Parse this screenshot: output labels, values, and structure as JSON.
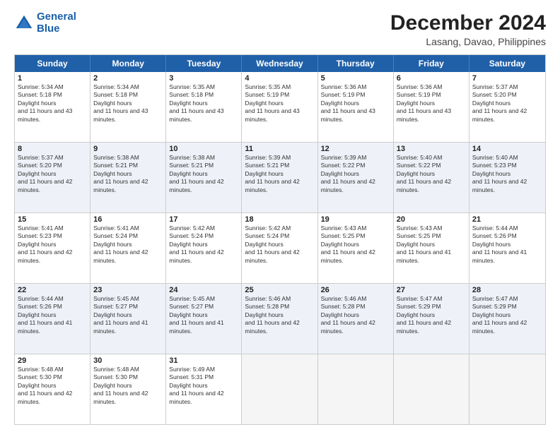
{
  "logo": {
    "line1": "General",
    "line2": "Blue"
  },
  "title": "December 2024",
  "subtitle": "Lasang, Davao, Philippines",
  "days": [
    "Sunday",
    "Monday",
    "Tuesday",
    "Wednesday",
    "Thursday",
    "Friday",
    "Saturday"
  ],
  "rows": [
    [
      {
        "day": "1",
        "rise": "5:34 AM",
        "set": "5:18 PM",
        "dl": "11 hours and 43 minutes."
      },
      {
        "day": "2",
        "rise": "5:34 AM",
        "set": "5:18 PM",
        "dl": "11 hours and 43 minutes."
      },
      {
        "day": "3",
        "rise": "5:35 AM",
        "set": "5:18 PM",
        "dl": "11 hours and 43 minutes."
      },
      {
        "day": "4",
        "rise": "5:35 AM",
        "set": "5:19 PM",
        "dl": "11 hours and 43 minutes."
      },
      {
        "day": "5",
        "rise": "5:36 AM",
        "set": "5:19 PM",
        "dl": "11 hours and 43 minutes."
      },
      {
        "day": "6",
        "rise": "5:36 AM",
        "set": "5:19 PM",
        "dl": "11 hours and 43 minutes."
      },
      {
        "day": "7",
        "rise": "5:37 AM",
        "set": "5:20 PM",
        "dl": "11 hours and 42 minutes."
      }
    ],
    [
      {
        "day": "8",
        "rise": "5:37 AM",
        "set": "5:20 PM",
        "dl": "11 hours and 42 minutes."
      },
      {
        "day": "9",
        "rise": "5:38 AM",
        "set": "5:21 PM",
        "dl": "11 hours and 42 minutes."
      },
      {
        "day": "10",
        "rise": "5:38 AM",
        "set": "5:21 PM",
        "dl": "11 hours and 42 minutes."
      },
      {
        "day": "11",
        "rise": "5:39 AM",
        "set": "5:21 PM",
        "dl": "11 hours and 42 minutes."
      },
      {
        "day": "12",
        "rise": "5:39 AM",
        "set": "5:22 PM",
        "dl": "11 hours and 42 minutes."
      },
      {
        "day": "13",
        "rise": "5:40 AM",
        "set": "5:22 PM",
        "dl": "11 hours and 42 minutes."
      },
      {
        "day": "14",
        "rise": "5:40 AM",
        "set": "5:23 PM",
        "dl": "11 hours and 42 minutes."
      }
    ],
    [
      {
        "day": "15",
        "rise": "5:41 AM",
        "set": "5:23 PM",
        "dl": "11 hours and 42 minutes."
      },
      {
        "day": "16",
        "rise": "5:41 AM",
        "set": "5:24 PM",
        "dl": "11 hours and 42 minutes."
      },
      {
        "day": "17",
        "rise": "5:42 AM",
        "set": "5:24 PM",
        "dl": "11 hours and 42 minutes."
      },
      {
        "day": "18",
        "rise": "5:42 AM",
        "set": "5:24 PM",
        "dl": "11 hours and 42 minutes."
      },
      {
        "day": "19",
        "rise": "5:43 AM",
        "set": "5:25 PM",
        "dl": "11 hours and 42 minutes."
      },
      {
        "day": "20",
        "rise": "5:43 AM",
        "set": "5:25 PM",
        "dl": "11 hours and 41 minutes."
      },
      {
        "day": "21",
        "rise": "5:44 AM",
        "set": "5:26 PM",
        "dl": "11 hours and 41 minutes."
      }
    ],
    [
      {
        "day": "22",
        "rise": "5:44 AM",
        "set": "5:26 PM",
        "dl": "11 hours and 41 minutes."
      },
      {
        "day": "23",
        "rise": "5:45 AM",
        "set": "5:27 PM",
        "dl": "11 hours and 41 minutes."
      },
      {
        "day": "24",
        "rise": "5:45 AM",
        "set": "5:27 PM",
        "dl": "11 hours and 41 minutes."
      },
      {
        "day": "25",
        "rise": "5:46 AM",
        "set": "5:28 PM",
        "dl": "11 hours and 42 minutes."
      },
      {
        "day": "26",
        "rise": "5:46 AM",
        "set": "5:28 PM",
        "dl": "11 hours and 42 minutes."
      },
      {
        "day": "27",
        "rise": "5:47 AM",
        "set": "5:29 PM",
        "dl": "11 hours and 42 minutes."
      },
      {
        "day": "28",
        "rise": "5:47 AM",
        "set": "5:29 PM",
        "dl": "11 hours and 42 minutes."
      }
    ],
    [
      {
        "day": "29",
        "rise": "5:48 AM",
        "set": "5:30 PM",
        "dl": "11 hours and 42 minutes."
      },
      {
        "day": "30",
        "rise": "5:48 AM",
        "set": "5:30 PM",
        "dl": "11 hours and 42 minutes."
      },
      {
        "day": "31",
        "rise": "5:49 AM",
        "set": "5:31 PM",
        "dl": "11 hours and 42 minutes."
      },
      null,
      null,
      null,
      null
    ]
  ]
}
